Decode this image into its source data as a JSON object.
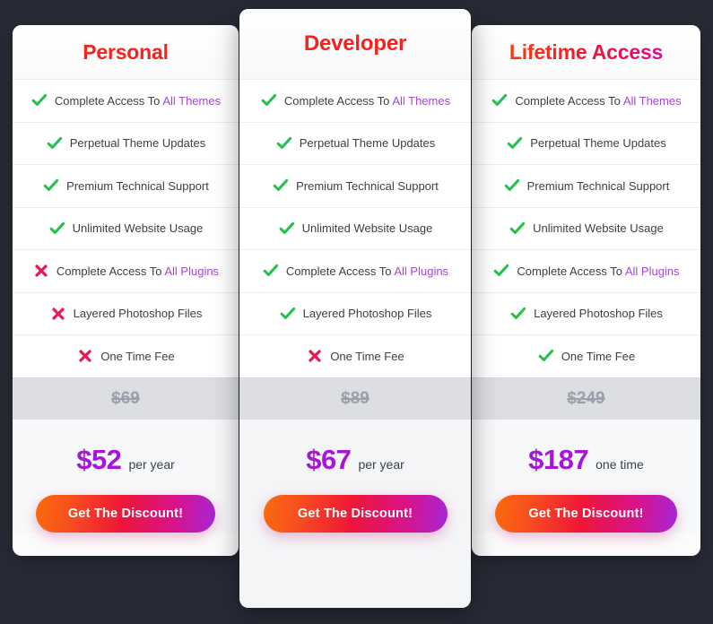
{
  "theme": {
    "page_background": "#282b36",
    "card_background": "#fbfbfc",
    "accent_purple": "#a248d8",
    "price_purple": "#a915d8",
    "check_green": "#27c24c",
    "cross_red": "#e8174e",
    "old_price_gray": "#9ba0ab",
    "old_price_band": "#dcdee2",
    "title_red": "#f4231e",
    "cta_gradient_from": "#f96b0e",
    "cta_gradient_to": "#a626d8"
  },
  "icons": {
    "check": "check-icon",
    "cross": "cross-icon"
  },
  "feature_labels": [
    {
      "prefix": "Complete Access To ",
      "highlight": "All Themes"
    },
    {
      "prefix": "Perpetual Theme Updates",
      "highlight": ""
    },
    {
      "prefix": "Premium Technical Support",
      "highlight": ""
    },
    {
      "prefix": "Unlimited Website Usage",
      "highlight": ""
    },
    {
      "prefix": "Complete Access To ",
      "highlight": "All Plugins"
    },
    {
      "prefix": "Layered Photoshop Files",
      "highlight": ""
    },
    {
      "prefix": "One Time Fee",
      "highlight": ""
    }
  ],
  "plans": [
    {
      "id": "personal",
      "title": "Personal",
      "featured": false,
      "availability": [
        "yes",
        "yes",
        "yes",
        "yes",
        "no",
        "no",
        "no"
      ],
      "old_price": "$69",
      "price": "$52",
      "period": "per year",
      "cta_label": "Get The Discount!"
    },
    {
      "id": "developer",
      "title": "Developer",
      "featured": true,
      "availability": [
        "yes",
        "yes",
        "yes",
        "yes",
        "yes",
        "yes",
        "no"
      ],
      "old_price": "$89",
      "price": "$67",
      "period": "per year",
      "cta_label": "Get The Discount!"
    },
    {
      "id": "lifetime",
      "title": "Lifetime Access",
      "featured": false,
      "availability": [
        "yes",
        "yes",
        "yes",
        "yes",
        "yes",
        "yes",
        "yes"
      ],
      "old_price": "$249",
      "price": "$187",
      "period": "one time",
      "cta_label": "Get The Discount!"
    }
  ]
}
